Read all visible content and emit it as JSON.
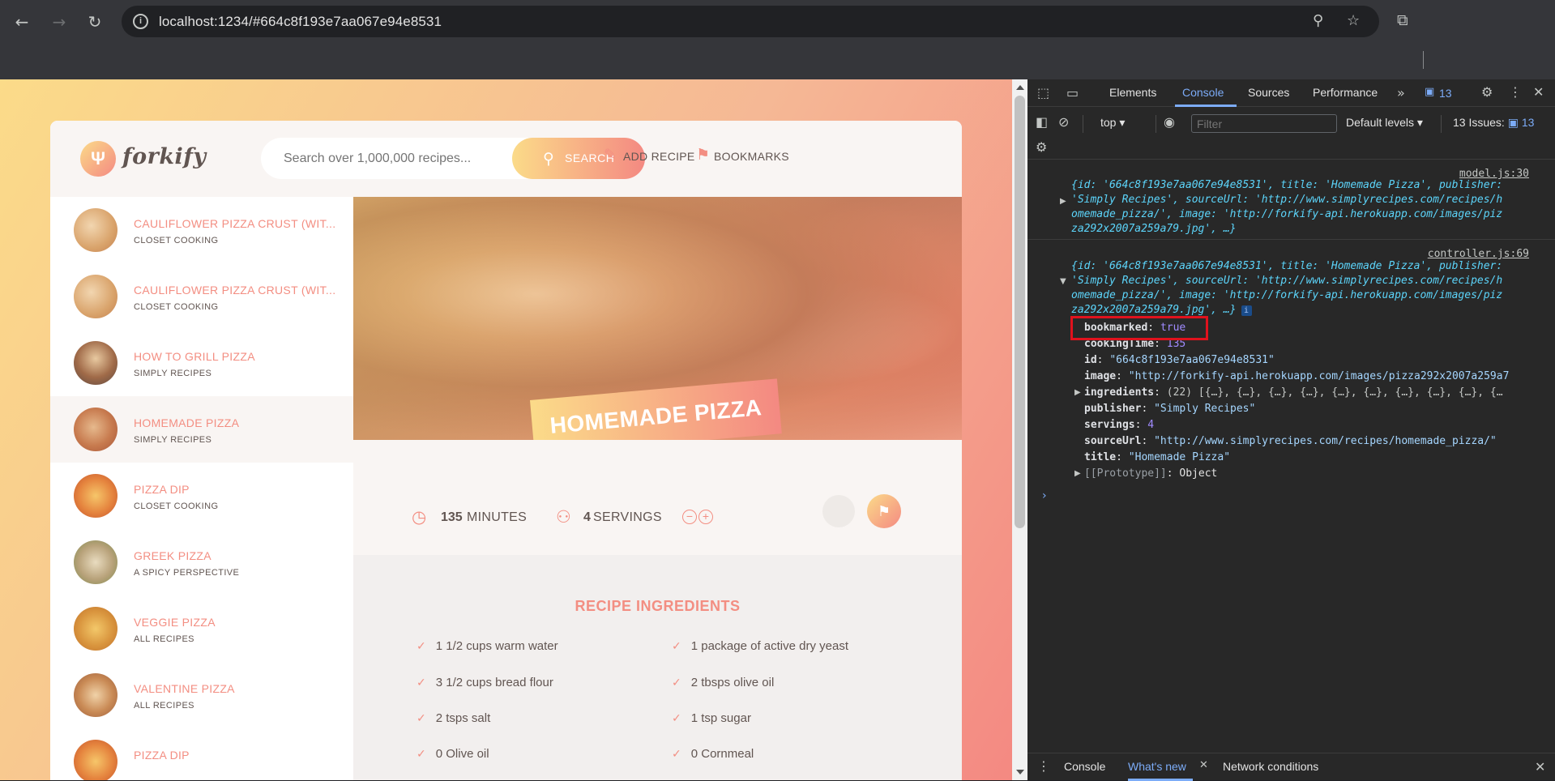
{
  "browser": {
    "url": "localhost:1234/#664c8f193e7aa067e94e8531",
    "icons": [
      "back-icon",
      "forward-icon",
      "reload-icon",
      "site-info-icon",
      "zoom-icon",
      "star-icon",
      "extensions-icon"
    ]
  },
  "app": {
    "logo_text": "forkify",
    "search_placeholder": "Search over 1,000,000 recipes...",
    "search_button": "SEARCH",
    "add_recipe": "ADD RECIPE",
    "bookmarks": "BOOKMARKS",
    "accent_color": "#f38e82",
    "results": [
      {
        "title": "CAULIFLOWER PIZZA CRUST (WIT...",
        "publisher": "CLOSET COOKING"
      },
      {
        "title": "CAULIFLOWER PIZZA CRUST (WIT...",
        "publisher": "CLOSET COOKING"
      },
      {
        "title": "HOW TO GRILL PIZZA",
        "publisher": "SIMPLY RECIPES"
      },
      {
        "title": "HOMEMADE PIZZA",
        "publisher": "SIMPLY RECIPES"
      },
      {
        "title": "PIZZA DIP",
        "publisher": "CLOSET COOKING"
      },
      {
        "title": "GREEK PIZZA",
        "publisher": "A SPICY PERSPECTIVE"
      },
      {
        "title": "VEGGIE PIZZA",
        "publisher": "ALL RECIPES"
      },
      {
        "title": "VALENTINE PIZZA",
        "publisher": "ALL RECIPES"
      },
      {
        "title": "PIZZA DIP",
        "publisher": ""
      }
    ],
    "recipe": {
      "title": "HOMEMADE PIZZA",
      "minutes": "135",
      "minutes_label": "MINUTES",
      "servings": "4",
      "servings_label": "SERVINGS",
      "ingredients_heading": "RECIPE INGREDIENTS",
      "ingredients": [
        "1 1/2 cups warm water",
        "1 package of active dry yeast",
        "3 1/2 cups bread flour",
        "2 tbsps olive oil",
        "2 tsps salt",
        "1 tsp sugar",
        "0 Olive oil",
        "0 Cornmeal"
      ]
    }
  },
  "devtools": {
    "tabs": [
      "Elements",
      "Console",
      "Sources",
      "Performance"
    ],
    "active_tab": "Console",
    "message_count": "13",
    "context": "top",
    "filter_placeholder": "Filter",
    "levels": "Default levels",
    "issues_label": "13 Issues:",
    "issues_count": "13",
    "log1": {
      "source": "model.js:30",
      "lines": [
        "{id: '664c8f193e7aa067e94e8531', title: 'Homemade Pizza', publisher:",
        "'Simply Recipes', sourceUrl: 'http://www.simplyrecipes.com/recipes/h",
        "omemade_pizza/', image: 'http://forkify-api.herokuapp.com/images/piz",
        "za292x2007a259a79.jpg', …}"
      ]
    },
    "log2": {
      "source": "controller.js:69",
      "lines": [
        "{id: '664c8f193e7aa067e94e8531', title: 'Homemade Pizza', publisher:",
        "'Simply Recipes', sourceUrl: 'http://www.simplyrecipes.com/recipes/h",
        "omemade_pizza/', image: 'http://forkify-api.herokuapp.com/images/piz",
        "za292x2007a259a79.jpg', …}"
      ],
      "props": [
        {
          "key": "bookmarked",
          "value": "true",
          "type": "bool"
        },
        {
          "key": "cookingTime",
          "value": "135",
          "type": "num"
        },
        {
          "key": "id",
          "value": "\"664c8f193e7aa067e94e8531\"",
          "type": "str"
        },
        {
          "key": "image",
          "value": "\"http://forkify-api.herokuapp.com/images/pizza292x2007a259a7",
          "type": "str"
        },
        {
          "key": "ingredients",
          "value": "(22) [{…}, {…}, {…}, {…}, {…}, {…}, {…}, {…}, {…}, {…",
          "type": "arr"
        },
        {
          "key": "publisher",
          "value": "\"Simply Recipes\"",
          "type": "str"
        },
        {
          "key": "servings",
          "value": "4",
          "type": "num"
        },
        {
          "key": "sourceUrl",
          "value": "\"http://www.simplyrecipes.com/recipes/homemade_pizza/\"",
          "type": "str"
        },
        {
          "key": "title",
          "value": "\"Homemade Pizza\"",
          "type": "str"
        },
        {
          "key": "[[Prototype]]",
          "value": "Object",
          "type": "proto"
        }
      ]
    },
    "drawer_tabs": [
      "Console",
      "What's new",
      "Network conditions"
    ],
    "drawer_active": "What's new"
  }
}
